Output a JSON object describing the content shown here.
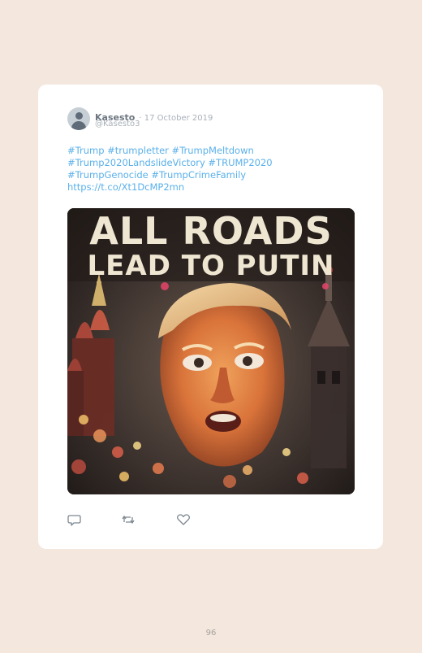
{
  "tweet": {
    "display_name": "Kasesto",
    "date": "17 October 2019",
    "handle": "@Kasesto3",
    "text_lines": [
      "#Trump #trumpletter #TrumpMeltdown",
      "#Trump2020LandslideVictory #TRUMP2020",
      "#TrumpGenocide #TrumpCrimeFamily",
      "https://t.co/Xt1DcMP2mn"
    ],
    "image_text_line1": "ALL ROADS",
    "image_text_line2": "LEAD TO PUTIN"
  },
  "actions": {
    "reply_icon": "reply-icon",
    "retweet_icon": "retweet-icon",
    "like_icon": "heart-icon"
  },
  "colors": {
    "background": "#f3e7de",
    "card": "#ffffff",
    "link": "#5ab0ea",
    "muted": "#a9b1b9",
    "name": "#6d7782"
  },
  "page_number": "96"
}
